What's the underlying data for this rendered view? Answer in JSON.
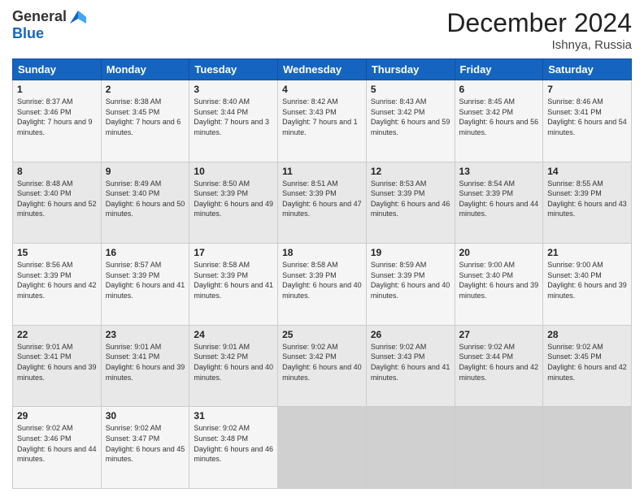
{
  "logo": {
    "general": "General",
    "blue": "Blue"
  },
  "title": "December 2024",
  "location": "Ishnya, Russia",
  "days_header": [
    "Sunday",
    "Monday",
    "Tuesday",
    "Wednesday",
    "Thursday",
    "Friday",
    "Saturday"
  ],
  "weeks": [
    [
      {
        "day": "1",
        "sunrise": "8:37 AM",
        "sunset": "3:46 PM",
        "daylight": "7 hours and 9 minutes."
      },
      {
        "day": "2",
        "sunrise": "8:38 AM",
        "sunset": "3:45 PM",
        "daylight": "7 hours and 6 minutes."
      },
      {
        "day": "3",
        "sunrise": "8:40 AM",
        "sunset": "3:44 PM",
        "daylight": "7 hours and 3 minutes."
      },
      {
        "day": "4",
        "sunrise": "8:42 AM",
        "sunset": "3:43 PM",
        "daylight": "7 hours and 1 minute."
      },
      {
        "day": "5",
        "sunrise": "8:43 AM",
        "sunset": "3:42 PM",
        "daylight": "6 hours and 59 minutes."
      },
      {
        "day": "6",
        "sunrise": "8:45 AM",
        "sunset": "3:42 PM",
        "daylight": "6 hours and 56 minutes."
      },
      {
        "day": "7",
        "sunrise": "8:46 AM",
        "sunset": "3:41 PM",
        "daylight": "6 hours and 54 minutes."
      }
    ],
    [
      {
        "day": "8",
        "sunrise": "8:48 AM",
        "sunset": "3:40 PM",
        "daylight": "6 hours and 52 minutes."
      },
      {
        "day": "9",
        "sunrise": "8:49 AM",
        "sunset": "3:40 PM",
        "daylight": "6 hours and 50 minutes."
      },
      {
        "day": "10",
        "sunrise": "8:50 AM",
        "sunset": "3:39 PM",
        "daylight": "6 hours and 49 minutes."
      },
      {
        "day": "11",
        "sunrise": "8:51 AM",
        "sunset": "3:39 PM",
        "daylight": "6 hours and 47 minutes."
      },
      {
        "day": "12",
        "sunrise": "8:53 AM",
        "sunset": "3:39 PM",
        "daylight": "6 hours and 46 minutes."
      },
      {
        "day": "13",
        "sunrise": "8:54 AM",
        "sunset": "3:39 PM",
        "daylight": "6 hours and 44 minutes."
      },
      {
        "day": "14",
        "sunrise": "8:55 AM",
        "sunset": "3:39 PM",
        "daylight": "6 hours and 43 minutes."
      }
    ],
    [
      {
        "day": "15",
        "sunrise": "8:56 AM",
        "sunset": "3:39 PM",
        "daylight": "6 hours and 42 minutes."
      },
      {
        "day": "16",
        "sunrise": "8:57 AM",
        "sunset": "3:39 PM",
        "daylight": "6 hours and 41 minutes."
      },
      {
        "day": "17",
        "sunrise": "8:58 AM",
        "sunset": "3:39 PM",
        "daylight": "6 hours and 41 minutes."
      },
      {
        "day": "18",
        "sunrise": "8:58 AM",
        "sunset": "3:39 PM",
        "daylight": "6 hours and 40 minutes."
      },
      {
        "day": "19",
        "sunrise": "8:59 AM",
        "sunset": "3:39 PM",
        "daylight": "6 hours and 40 minutes."
      },
      {
        "day": "20",
        "sunrise": "9:00 AM",
        "sunset": "3:40 PM",
        "daylight": "6 hours and 39 minutes."
      },
      {
        "day": "21",
        "sunrise": "9:00 AM",
        "sunset": "3:40 PM",
        "daylight": "6 hours and 39 minutes."
      }
    ],
    [
      {
        "day": "22",
        "sunrise": "9:01 AM",
        "sunset": "3:41 PM",
        "daylight": "6 hours and 39 minutes."
      },
      {
        "day": "23",
        "sunrise": "9:01 AM",
        "sunset": "3:41 PM",
        "daylight": "6 hours and 39 minutes."
      },
      {
        "day": "24",
        "sunrise": "9:01 AM",
        "sunset": "3:42 PM",
        "daylight": "6 hours and 40 minutes."
      },
      {
        "day": "25",
        "sunrise": "9:02 AM",
        "sunset": "3:42 PM",
        "daylight": "6 hours and 40 minutes."
      },
      {
        "day": "26",
        "sunrise": "9:02 AM",
        "sunset": "3:43 PM",
        "daylight": "6 hours and 41 minutes."
      },
      {
        "day": "27",
        "sunrise": "9:02 AM",
        "sunset": "3:44 PM",
        "daylight": "6 hours and 42 minutes."
      },
      {
        "day": "28",
        "sunrise": "9:02 AM",
        "sunset": "3:45 PM",
        "daylight": "6 hours and 42 minutes."
      }
    ],
    [
      {
        "day": "29",
        "sunrise": "9:02 AM",
        "sunset": "3:46 PM",
        "daylight": "6 hours and 44 minutes."
      },
      {
        "day": "30",
        "sunrise": "9:02 AM",
        "sunset": "3:47 PM",
        "daylight": "6 hours and 45 minutes."
      },
      {
        "day": "31",
        "sunrise": "9:02 AM",
        "sunset": "3:48 PM",
        "daylight": "6 hours and 46 minutes."
      },
      null,
      null,
      null,
      null
    ]
  ],
  "labels": {
    "sunrise": "Sunrise:",
    "sunset": "Sunset:",
    "daylight": "Daylight:"
  }
}
